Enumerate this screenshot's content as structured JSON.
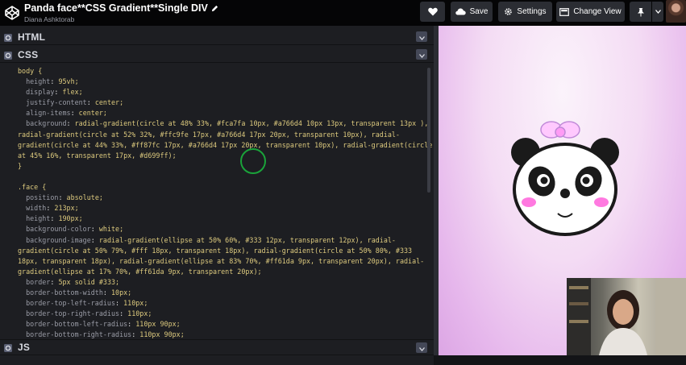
{
  "header": {
    "title": "Panda face**CSS Gradient**Single DIV",
    "author": "Diana Ashktorab",
    "save_label": "Save",
    "settings_label": "Settings",
    "change_view_label": "Change View"
  },
  "panes": {
    "html_label": "HTML",
    "css_label": "CSS",
    "js_label": "JS"
  },
  "css_code": [
    "body {",
    "  height: 95vh;",
    "  display: flex;",
    "  justify-content: center;",
    "  align-items: center;",
    "  background: radial-gradient(circle at 48% 33%, #fca7fa 10px, #a766d4 10px 13px, transparent 13px ),",
    "radial-gradient(circle at 52% 32%, #ffc9fe 17px, #a766d4 17px 20px, transparent 10px), radial-",
    "gradient(circle at 44% 33%, #ff87fc 17px, #a766d4 17px 20px, transparent 10px), radial-gradient(circle",
    "at 45% 16%, transparent 17px, #d699ff);",
    "}",
    "",
    ".face {",
    "  position: absolute;",
    "  width: 213px;",
    "  height: 190px;",
    "  background-color: white;",
    "  background-image: radial-gradient(ellipse at 50% 60%, #333 12px, transparent 12px), radial-",
    "gradient(circle at 50% 79%, #fff 18px, transparent 18px), radial-gradient(circle at 50% 80%, #333",
    "18px, transparent 18px), radial-gradient(ellipse at 83% 70%, #ff61da 9px, transparent 20px), radial-",
    "gradient(ellipse at 17% 70%, #ff61da 9px, transparent 20px);",
    "  border: 5px solid #333;",
    "  border-bottom-width: 10px;",
    "  border-top-left-radius: 110px;",
    "  border-top-right-radius: 110px;",
    "  border-bottom-left-radius: 110px 90px;",
    "  border-bottom-right-radius: 110px 90px;"
  ],
  "colors": {
    "header_bg": "#050506",
    "editor_bg": "#1d1e22",
    "button_bg": "#2b2d33",
    "code_value": "#ddca7e",
    "code_property": "#9a9ca6",
    "panda_black": "#1a1a1a",
    "bow_pink": "#ffc9fe",
    "cheek_pink": "#ff61da"
  }
}
